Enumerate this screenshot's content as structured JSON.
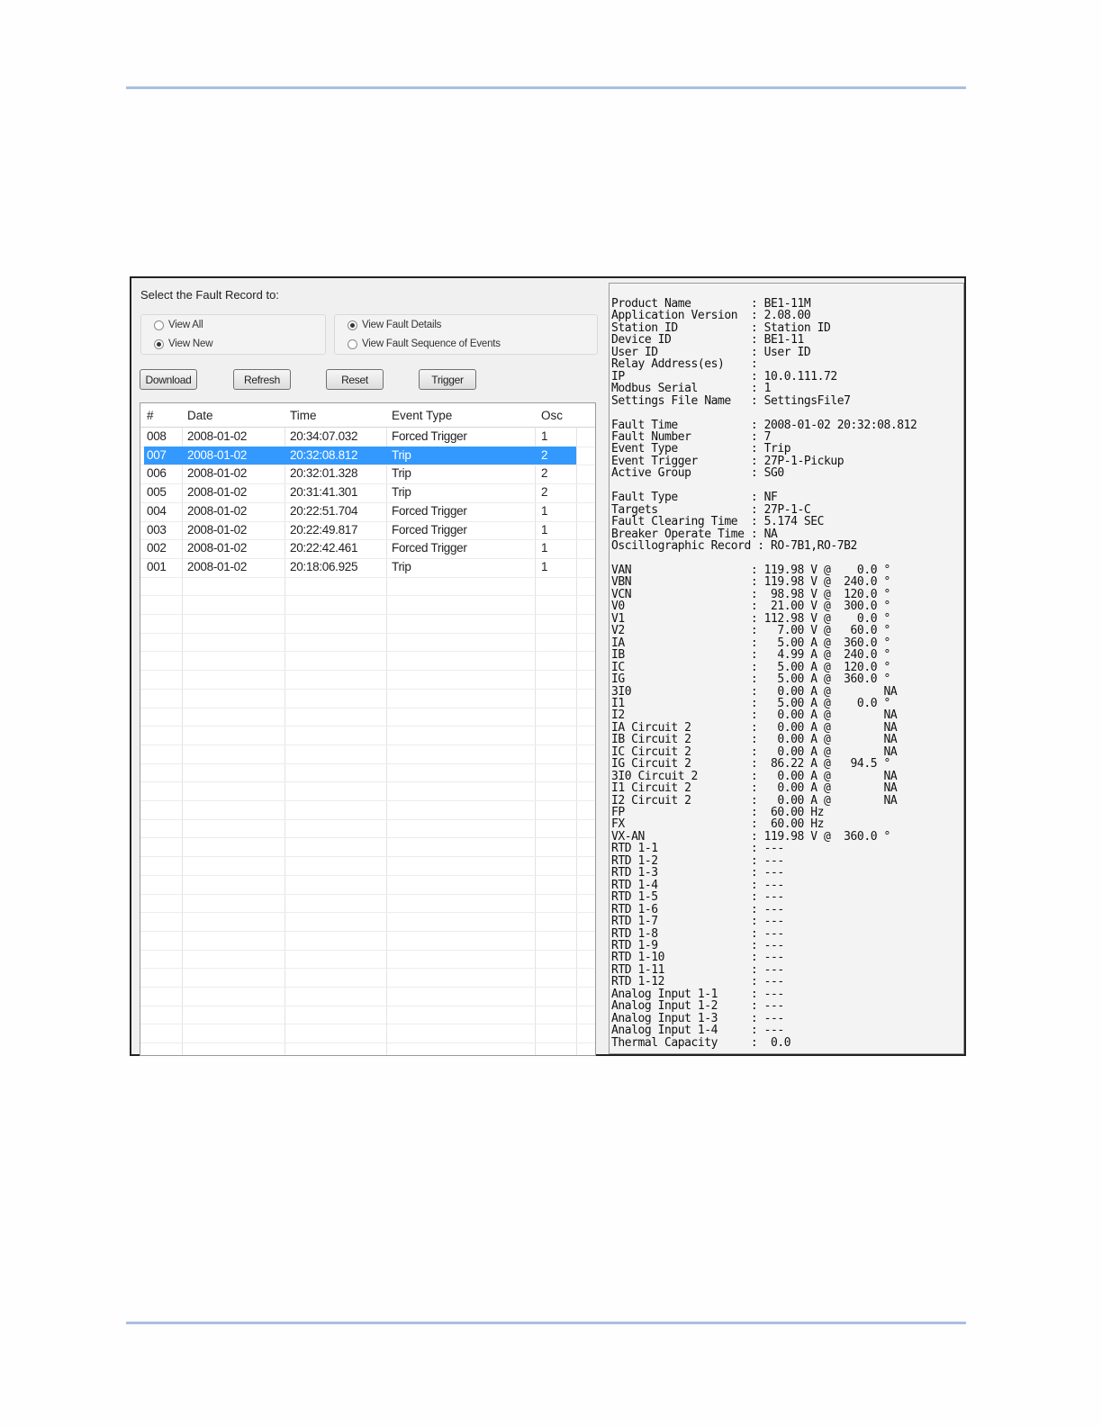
{
  "panel": {
    "prompt": "Select the Fault Record to:",
    "view_options": [
      {
        "label": "View All",
        "selected": false
      },
      {
        "label": "View New",
        "selected": true
      }
    ],
    "detail_options": [
      {
        "label": "View Fault Details",
        "selected": true
      },
      {
        "label": "View Fault Sequence of Events",
        "selected": false
      }
    ],
    "buttons": {
      "download": "Download",
      "refresh": "Refresh",
      "reset": "Reset",
      "trigger": "Trigger"
    }
  },
  "records": {
    "columns": [
      "#",
      "Date",
      "Time",
      "Event Type",
      "Osc"
    ],
    "selected_index": 1,
    "selection_color": "#3399ff",
    "rows": [
      [
        "008",
        "2008-01-02",
        "20:34:07.032",
        "Forced Trigger",
        "1"
      ],
      [
        "007",
        "2008-01-02",
        "20:32:08.812",
        "Trip",
        "2"
      ],
      [
        "006",
        "2008-01-02",
        "20:32:01.328",
        "Trip",
        "2"
      ],
      [
        "005",
        "2008-01-02",
        "20:31:41.301",
        "Trip",
        "2"
      ],
      [
        "004",
        "2008-01-02",
        "20:22:51.704",
        "Forced Trigger",
        "1"
      ],
      [
        "003",
        "2008-01-02",
        "20:22:49.817",
        "Forced Trigger",
        "1"
      ],
      [
        "002",
        "2008-01-02",
        "20:22:42.461",
        "Forced Trigger",
        "1"
      ],
      [
        "001",
        "2008-01-02",
        "20:18:06.925",
        "Trip",
        "1"
      ]
    ]
  },
  "report": {
    "lines": [
      "Product Name         : BE1-11M",
      "Application Version  : 2.08.00",
      "Station ID           : Station ID",
      "Device ID            : BE1-11",
      "User ID              : User ID",
      "Relay Address(es)    :",
      "IP                   : 10.0.111.72",
      "Modbus Serial        : 1",
      "Settings File Name   : SettingsFile7",
      "",
      "Fault Time           : 2008-01-02 20:32:08.812",
      "Fault Number         : 7",
      "Event Type           : Trip",
      "Event Trigger        : 27P-1-Pickup",
      "Active Group         : SG0",
      "",
      "Fault Type           : NF",
      "Targets              : 27P-1-C",
      "Fault Clearing Time  : 5.174 SEC",
      "Breaker Operate Time : NA",
      "Oscillographic Record : RO-7B1,RO-7B2",
      "",
      "VAN                  : 119.98 V @    0.0 °",
      "VBN                  : 119.98 V @  240.0 °",
      "VCN                  :  98.98 V @  120.0 °",
      "V0                   :  21.00 V @  300.0 °",
      "V1                   : 112.98 V @    0.0 °",
      "V2                   :   7.00 V @   60.0 °",
      "IA                   :   5.00 A @  360.0 °",
      "IB                   :   4.99 A @  240.0 °",
      "IC                   :   5.00 A @  120.0 °",
      "IG                   :   5.00 A @  360.0 °",
      "3I0                  :   0.00 A @        NA",
      "I1                   :   5.00 A @    0.0 °",
      "I2                   :   0.00 A @        NA",
      "IA Circuit 2         :   0.00 A @        NA",
      "IB Circuit 2         :   0.00 A @        NA",
      "IC Circuit 2         :   0.00 A @        NA",
      "IG Circuit 2         :  86.22 A @   94.5 °",
      "3I0 Circuit 2        :   0.00 A @        NA",
      "I1 Circuit 2         :   0.00 A @        NA",
      "I2 Circuit 2         :   0.00 A @        NA",
      "FP                   :  60.00 Hz",
      "FX                   :  60.00 Hz",
      "VX-AN                : 119.98 V @  360.0 °",
      "RTD 1-1              : ---",
      "RTD 1-2              : ---",
      "RTD 1-3              : ---",
      "RTD 1-4              : ---",
      "RTD 1-5              : ---",
      "RTD 1-6              : ---",
      "RTD 1-7              : ---",
      "RTD 1-8              : ---",
      "RTD 1-9              : ---",
      "RTD 1-10             : ---",
      "RTD 1-11             : ---",
      "RTD 1-12             : ---",
      "Analog Input 1-1     : ---",
      "Analog Input 1-2     : ---",
      "Analog Input 1-3     : ---",
      "Analog Input 1-4     : ---",
      "Thermal Capacity     :  0.0"
    ]
  }
}
